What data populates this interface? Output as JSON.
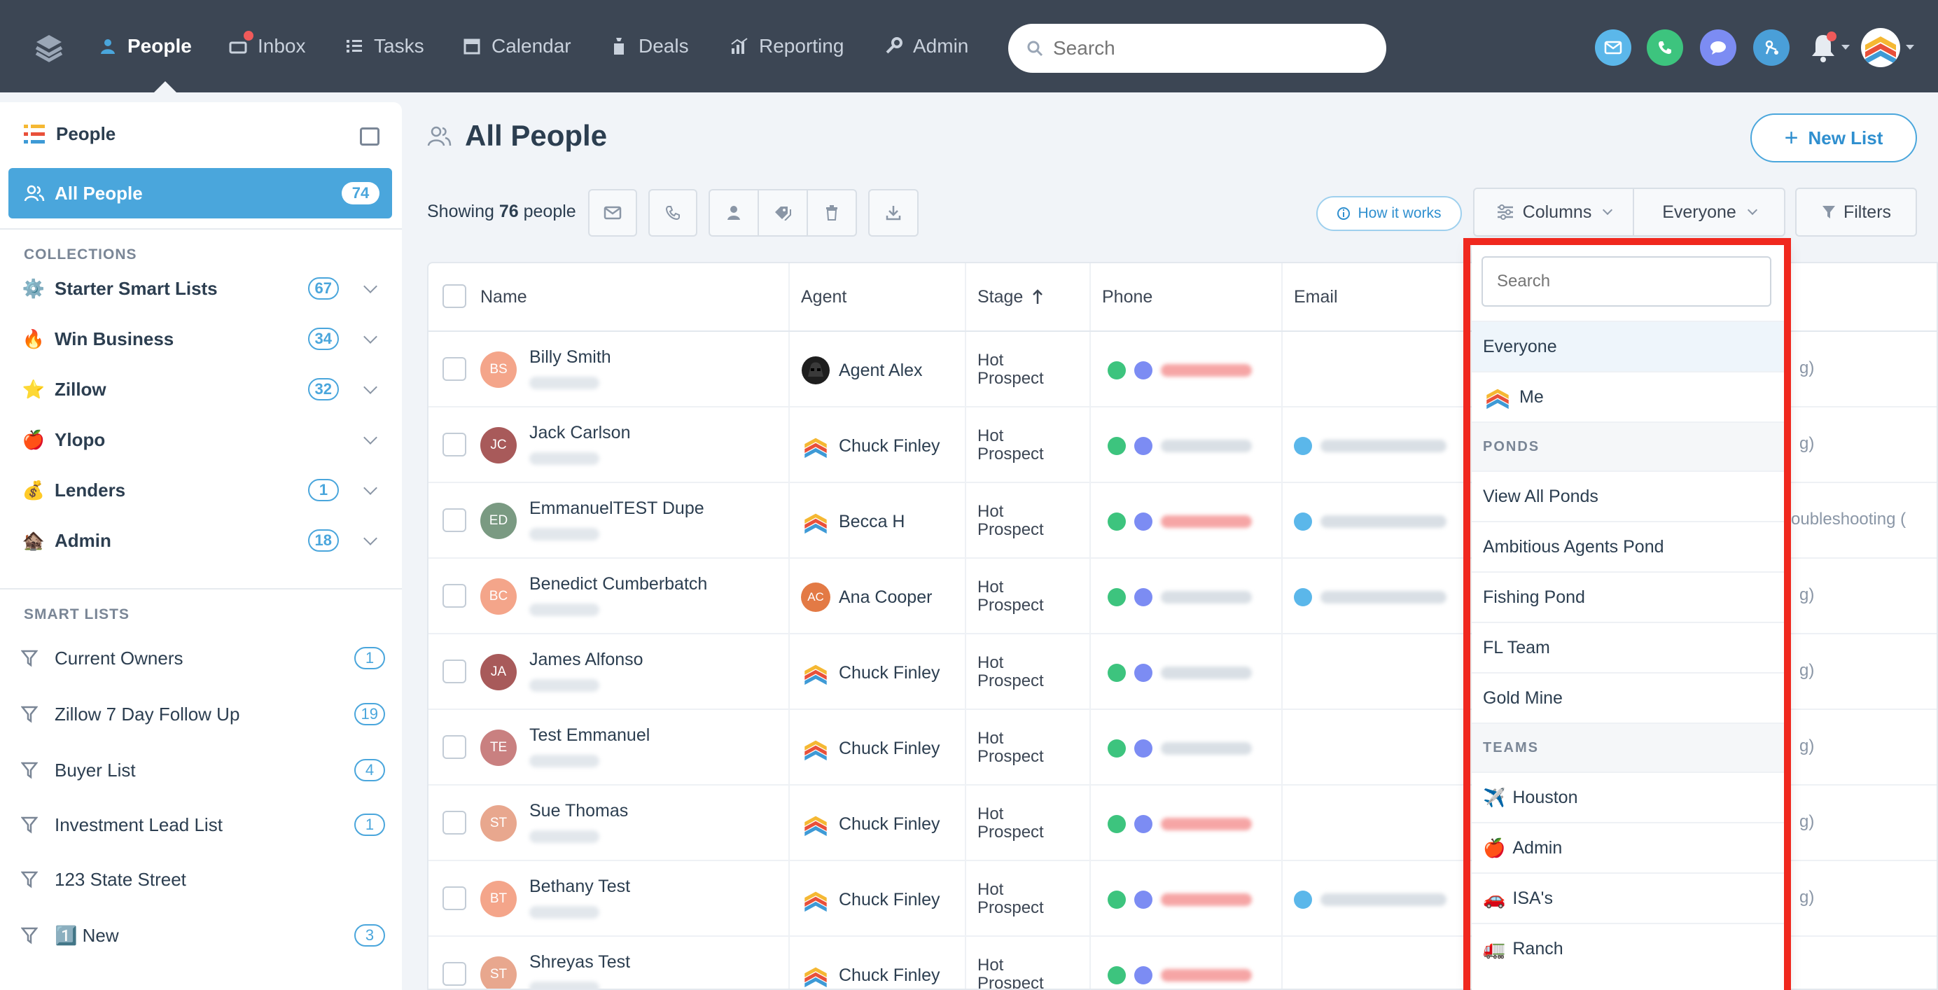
{
  "nav": {
    "items": [
      {
        "label": "People",
        "icon": "people-icon",
        "active": true
      },
      {
        "label": "Inbox",
        "icon": "inbox-icon"
      },
      {
        "label": "Tasks",
        "icon": "tasks-icon"
      },
      {
        "label": "Calendar",
        "icon": "calendar-icon"
      },
      {
        "label": "Deals",
        "icon": "deals-icon"
      },
      {
        "label": "Reporting",
        "icon": "reporting-icon"
      },
      {
        "label": "Admin",
        "icon": "admin-wrench-icon"
      }
    ],
    "search_placeholder": "Search",
    "colors": {
      "bg": "#3c4654",
      "email": "#5bb7ea",
      "phone": "#3dc47e",
      "chat": "#7c8cf3",
      "dialer": "#4a9fd8"
    }
  },
  "sidebar": {
    "title": "People",
    "active_item": {
      "label": "All People",
      "count": "74"
    },
    "collections_label": "COLLECTIONS",
    "collections": [
      {
        "emoji": "⚙️",
        "label": "Starter Smart Lists",
        "count": "67"
      },
      {
        "emoji": "🔥",
        "label": "Win Business",
        "count": "34"
      },
      {
        "emoji": "⭐",
        "label": "Zillow",
        "count": "32"
      },
      {
        "emoji": "🍎",
        "label": "Ylopo",
        "count": ""
      },
      {
        "emoji": "💰",
        "label": "Lenders",
        "count": "1"
      },
      {
        "emoji": "🏚️",
        "label": "Admin",
        "count": "18"
      }
    ],
    "smart_lists_label": "SMART LISTS",
    "smart_lists": [
      {
        "label": "Current Owners",
        "count": "1"
      },
      {
        "label": "Zillow 7 Day Follow Up",
        "count": "19"
      },
      {
        "label": "Buyer List",
        "count": "4"
      },
      {
        "label": "Investment Lead List",
        "count": "1"
      },
      {
        "label": "123 State Street",
        "count": ""
      },
      {
        "label": "1️⃣ New",
        "count": "3"
      }
    ]
  },
  "main": {
    "title": "All People",
    "new_list_label": "New List",
    "showing_prefix": "Showing",
    "showing_count": "76",
    "showing_suffix": "people",
    "how_it_works": "How it works",
    "columns_label": "Columns",
    "everyone_label": "Everyone",
    "filters_label": "Filters"
  },
  "table": {
    "headers": {
      "name": "Name",
      "agent": "Agent",
      "stage": "Stage",
      "phone": "Phone",
      "email": "Email"
    },
    "rows": [
      {
        "initials": "BS",
        "avatar_color": "#f4a58a",
        "name": "Billy Smith",
        "agent": "Agent Alex",
        "agent_icon": "darth-vader-icon",
        "stage": "Hot Prospect",
        "phone_color": "#f6a5a5",
        "has_email": false
      },
      {
        "initials": "JC",
        "avatar_color": "#a85a5a",
        "name": "Jack Carlson",
        "agent": "Chuck Finley",
        "agent_icon": "chevron-logo-icon",
        "stage": "Hot Prospect",
        "phone_color": "#d9dfe5",
        "has_email": true
      },
      {
        "initials": "ED",
        "avatar_color": "#7a9a82",
        "name": "EmmanuelTEST Dupe",
        "agent": "Becca H",
        "agent_icon": "chevron-logo-icon",
        "stage": "Hot Prospect",
        "phone_color": "#f6a5a5",
        "has_email": true
      },
      {
        "initials": "BC",
        "avatar_color": "#f4a58a",
        "name": "Benedict Cumberbatch",
        "agent": "Ana Cooper",
        "agent_icon": "initials-ac",
        "stage": "Hot Prospect",
        "phone_color": "#d9dfe5",
        "has_email": true
      },
      {
        "initials": "JA",
        "avatar_color": "#a85a5a",
        "name": "James Alfonso",
        "agent": "Chuck Finley",
        "agent_icon": "chevron-logo-icon",
        "stage": "Hot Prospect",
        "phone_color": "#d9dfe5",
        "has_email": false
      },
      {
        "initials": "TE",
        "avatar_color": "#c98080",
        "name": "Test Emmanuel",
        "agent": "Chuck Finley",
        "agent_icon": "chevron-logo-icon",
        "stage": "Hot Prospect",
        "phone_color": "#d9dfe5",
        "has_email": false
      },
      {
        "initials": "ST",
        "avatar_color": "#e8a78e",
        "name": "Sue Thomas",
        "agent": "Chuck Finley",
        "agent_icon": "chevron-logo-icon",
        "stage": "Hot Prospect",
        "phone_color": "#f6a5a5",
        "has_email": false
      },
      {
        "initials": "BT",
        "avatar_color": "#f4a58a",
        "name": "Bethany Test",
        "agent": "Chuck Finley",
        "agent_icon": "chevron-logo-icon",
        "stage": "Hot Prospect",
        "phone_color": "#f6a5a5",
        "has_email": true
      },
      {
        "initials": "ST",
        "avatar_color": "#e8a78e",
        "name": "Shreyas Test",
        "agent": "Chuck Finley",
        "agent_icon": "chevron-logo-icon",
        "stage": "Hot Prospect",
        "phone_color": "#f6a5a5",
        "has_email": false
      }
    ],
    "right_fragments": [
      "g)",
      "g)",
      "roubleshooting (",
      "g)",
      "g)",
      "g)",
      "g)",
      "g)"
    ]
  },
  "dropdown": {
    "search_placeholder": "Search",
    "items_top": [
      {
        "label": "Everyone",
        "emoji": "",
        "selected": true
      },
      {
        "label": "Me",
        "emoji": "logo"
      }
    ],
    "ponds_label": "PONDS",
    "ponds": [
      "View All Ponds",
      "Ambitious Agents Pond",
      "Fishing Pond",
      "FL Team",
      "Gold Mine"
    ],
    "teams_label": "TEAMS",
    "teams": [
      {
        "emoji": "✈️",
        "label": "Houston"
      },
      {
        "emoji": "🍎",
        "label": "Admin"
      },
      {
        "emoji": "🚗",
        "label": "ISA's"
      },
      {
        "emoji": "🚛",
        "label": "Ranch"
      }
    ],
    "highlight_color": "#f0281e"
  }
}
